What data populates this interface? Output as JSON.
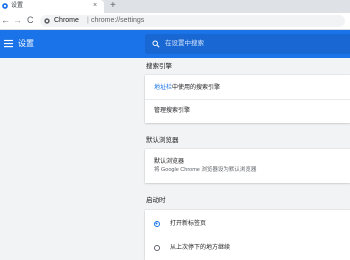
{
  "browser": {
    "tab_title": "设置",
    "tab_close": "×",
    "new_tab": "+",
    "back": "←",
    "forward": "→",
    "reload": "C",
    "site_label": "Chrome",
    "separator": "|",
    "url": "chrome://settings"
  },
  "header": {
    "title": "设置",
    "search_placeholder": "在设置中搜索"
  },
  "sections": {
    "search_engine": {
      "title": "搜索引擎",
      "row1_link": "地址栏",
      "row1_text": "中使用的搜索引擎",
      "row2": "管理搜索引擎"
    },
    "default_browser": {
      "title": "默认浏览器",
      "row_title": "默认浏览器",
      "row_subtitle": "将 Google Chrome 浏览器设为默认浏览器"
    },
    "on_startup": {
      "title": "启动时",
      "options": [
        {
          "label": "打开新标签页",
          "selected": true
        },
        {
          "label": "从上次停下的地方继续",
          "selected": false
        }
      ]
    }
  },
  "colors": {
    "accent": "#1a73e8",
    "header_bg": "#1a73e8",
    "search_bg": "#1967d2",
    "page_bg": "#f1f3f4"
  }
}
